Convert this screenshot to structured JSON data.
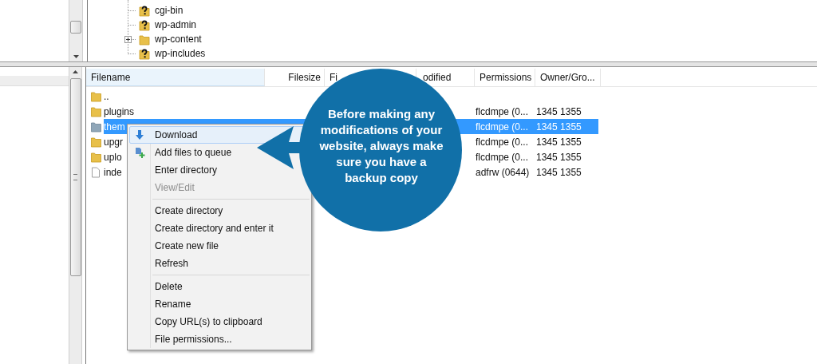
{
  "tree": {
    "items": [
      {
        "label": "cgi-bin",
        "kind": "unknown",
        "expandable": false
      },
      {
        "label": "wp-admin",
        "kind": "unknown",
        "expandable": false
      },
      {
        "label": "wp-content",
        "kind": "folder",
        "expandable": true
      },
      {
        "label": "wp-includes",
        "kind": "unknown",
        "expandable": false
      }
    ]
  },
  "file_list": {
    "columns": [
      "Filename",
      "Filesize",
      "Fi",
      "odified",
      "Permissions",
      "Owner/Gro..."
    ],
    "rows": [
      {
        "name": "..",
        "kind": "folder",
        "selected": false
      },
      {
        "name": "plugins",
        "kind": "folder",
        "selected": false,
        "permissions": "flcdmpe (0...",
        "owner": "1345 1355"
      },
      {
        "name": "them",
        "kind": "folder",
        "selected": true,
        "permissions": "flcdmpe (0...",
        "owner": "1345 1355"
      },
      {
        "name": "upgr",
        "kind": "folder",
        "selected": false,
        "permissions": "flcdmpe (0...",
        "owner": "1345 1355"
      },
      {
        "name": "uplo",
        "kind": "folder",
        "selected": false,
        "permissions": "flcdmpe (0...",
        "owner": "1345 1355"
      },
      {
        "name": "inde",
        "kind": "file",
        "selected": false,
        "permissions": "adfrw (0644)",
        "owner": "1345 1355"
      }
    ]
  },
  "context_menu": {
    "items": [
      {
        "kind": "download",
        "label": "Download",
        "disabled": false,
        "selected": true
      },
      {
        "kind": "queue",
        "label": "Add files to queue",
        "disabled": false,
        "selected": false
      },
      {
        "kind": "item",
        "label": "Enter directory",
        "disabled": false,
        "selected": false
      },
      {
        "kind": "item",
        "label": "View/Edit",
        "disabled": true,
        "selected": false
      },
      {
        "kind": "separator"
      },
      {
        "kind": "item",
        "label": "Create directory",
        "disabled": false,
        "selected": false
      },
      {
        "kind": "item",
        "label": "Create directory and enter it",
        "disabled": false,
        "selected": false
      },
      {
        "kind": "item",
        "label": "Create new file",
        "disabled": false,
        "selected": false
      },
      {
        "kind": "item",
        "label": "Refresh",
        "disabled": false,
        "selected": false
      },
      {
        "kind": "separator"
      },
      {
        "kind": "item",
        "label": "Delete",
        "disabled": false,
        "selected": false
      },
      {
        "kind": "item",
        "label": "Rename",
        "disabled": false,
        "selected": false
      },
      {
        "kind": "item",
        "label": "Copy URL(s) to clipboard",
        "disabled": false,
        "selected": false
      },
      {
        "kind": "item",
        "label": "File permissions...",
        "disabled": false,
        "selected": false
      }
    ]
  },
  "callout": {
    "text": "Before making any modifications of your website, always make sure you have a backup copy"
  }
}
